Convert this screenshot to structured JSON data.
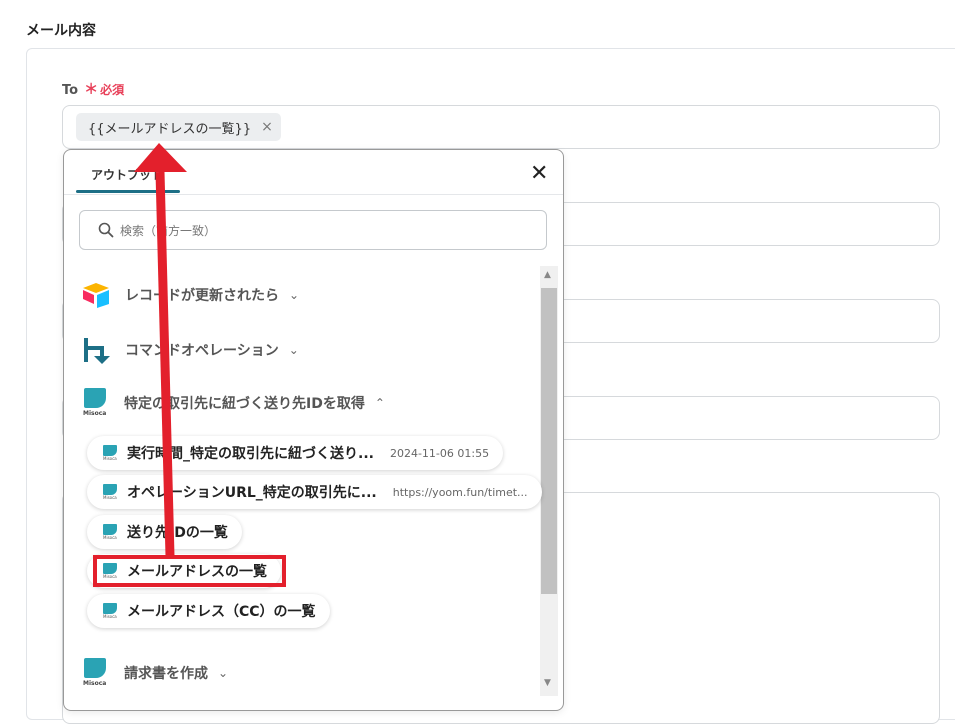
{
  "section": {
    "title": "メール内容"
  },
  "to_field": {
    "label": "To",
    "required_mark": "＊",
    "required_label": "必須",
    "chip_text": "{{メールアドレスの一覧}}",
    "chip_remove": "×"
  },
  "popup": {
    "tab_label": "アウトプット",
    "close_glyph": "✕",
    "search_placeholder": "検索（前方一致）",
    "groups": [
      {
        "label": "レコードが更新されたら",
        "icon": "airtable-icon",
        "expanded": false
      },
      {
        "label": "コマンドオペレーション",
        "icon": "yoom-command-icon",
        "expanded": false
      },
      {
        "label": "特定の取引先に紐づく送り先IDを取得",
        "icon": "misoca-icon",
        "expanded": true
      },
      {
        "label": "請求書を作成",
        "icon": "misoca-icon",
        "expanded": false
      }
    ],
    "items": [
      {
        "name": "実行時間_特定の取引先に紐づく送り...",
        "value": "2024-11-06 01:55"
      },
      {
        "name": "オペレーションURL_特定の取引先に...",
        "value": "https://yoom.fun/timet..."
      },
      {
        "name": "送り先IDの一覧",
        "value": ""
      },
      {
        "name": "メールアドレスの一覧",
        "value": ""
      },
      {
        "name": "メールアドレス（CC）の一覧",
        "value": ""
      }
    ],
    "icon_caption": "Misoca",
    "chevron_down": "⌄",
    "chevron_up": "⌃"
  },
  "annotation": {
    "highlight_color": "#e3202c",
    "highlighted_item": "メールアドレスの一覧"
  },
  "colors": {
    "accent": "#1d6f86",
    "required": "#e8415a",
    "misoca": "#2aa3b4"
  }
}
